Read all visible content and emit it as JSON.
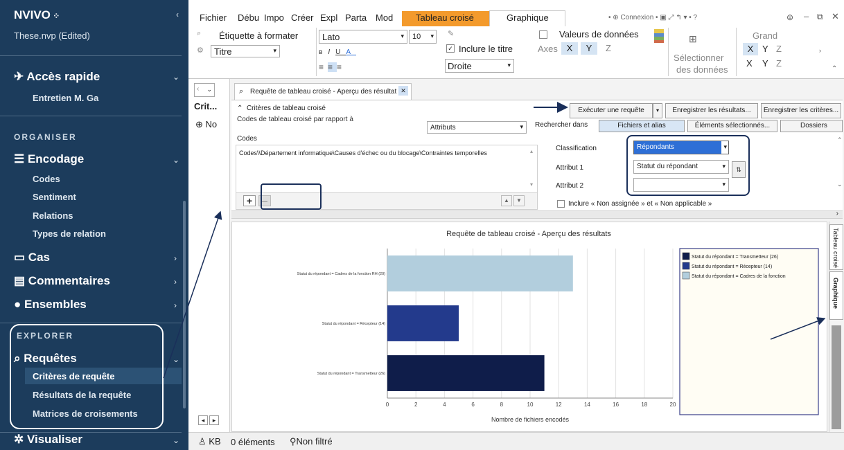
{
  "sidebar": {
    "app_name": "NVIVO",
    "project_name": "These.nvp (Edited)",
    "quick_access": {
      "label": "Accès rapide",
      "item": "Entretien M. Ga"
    },
    "organize_title": "ORGANISER",
    "encoding": {
      "label": "Encodage",
      "items": [
        "Codes",
        "Sentiment",
        "Relations",
        "Types de relation"
      ]
    },
    "cases": "Cas",
    "comments": "Commentaires",
    "sets": "Ensembles",
    "explore_title": "EXPLORER",
    "queries": {
      "label": "Requêtes",
      "items": [
        "Critères de requête",
        "Résultats de la requête",
        "Matrices de croisements"
      ]
    },
    "visualize": "Visualiser"
  },
  "ribbon": {
    "tabs": [
      "Fichier",
      "Débu",
      "Impo",
      "Créer",
      "Expl",
      "Parta",
      "Mod"
    ],
    "context_tab": "Tableau croisé",
    "active_tab": "Graphique",
    "connexion": "Connexion",
    "label_to_format": "Étiquette à formater",
    "title_select": "Titre",
    "font_name": "Lato",
    "font_size": "10",
    "include_title": "Inclure le titre",
    "position_select": "Droite",
    "data_values": "Valeurs de données",
    "axes_label": "Axes",
    "axis_x": "X",
    "axis_y": "Y",
    "axis_z": "Z",
    "select_data": [
      "Sélectionner",
      "des données"
    ],
    "grand_label": "Grand"
  },
  "query": {
    "list_header": "Crit...",
    "list_item": "No",
    "doc_tab": "Requête de tableau croisé - Aperçu des résultat",
    "criteria_header": "Critères de tableau croisé",
    "run_button": "Exécuter une requête",
    "save_results_button": "Enregistrer les résultats...",
    "save_criteria_button": "Enregistrer les critères...",
    "codes_vs_label": "Codes de tableau croisé par rapport à",
    "attributes_select": "Attributs",
    "search_in_label": "Rechercher dans",
    "search_tabs": [
      "Fichiers et alias",
      "Éléments sélectionnés...",
      "Dossiers"
    ],
    "codes_label": "Codes",
    "code_path": "Codes\\\\Département informatique\\Causes d'échec ou du blocage\\Contraintes temporelles",
    "classification_label": "Classification",
    "classification_value": "Répondants",
    "attribute1_label": "Attribut 1",
    "attribute1_value": "Statut du répondant",
    "attribute2_label": "Attribut 2",
    "attribute2_value": "",
    "include_unassigned": "Inclure « Non assignée » et « Non applicable »"
  },
  "side_tabs": [
    "Tableau croisé",
    "Graphique"
  ],
  "status": {
    "user": "KB",
    "items": "0 éléments",
    "filter": "Non filtré"
  },
  "colors": {
    "sidebar": "#1c3c5c",
    "context_tab": "#f39a2c",
    "series_dark": "#0f1d4a",
    "series_mid": "#233a8c",
    "series_light": "#b2cedd",
    "highlight": "#2e6fd6"
  },
  "chart_data": {
    "type": "bar",
    "orientation": "horizontal",
    "title": "Requête de tableau croisé - Aperçu des résultats",
    "xlabel": "Nombre de fichiers encodés",
    "categories": [
      "Statut du répondant = Cadres de la fonction RH (20)",
      "Statut du répondant = Récepteur (14)",
      "Statut du répondant = Transmetteur (26)"
    ],
    "values": [
      13,
      5,
      11
    ],
    "colors": [
      "#b2cedd",
      "#233a8c",
      "#0f1d4a"
    ],
    "xlim": [
      0,
      20
    ],
    "xticks": [
      0,
      2,
      4,
      6,
      8,
      10,
      12,
      14,
      16,
      18,
      20
    ],
    "legend": [
      "Statut du répondant = Transmetteur (26)",
      "Statut du répondant = Récepteur (14)",
      "Statut du répondant = Cadres de la fonction"
    ],
    "legend_colors": [
      "#0f1d4a",
      "#233a8c",
      "#b2cedd"
    ],
    "legend_position": "right",
    "grid": true
  }
}
